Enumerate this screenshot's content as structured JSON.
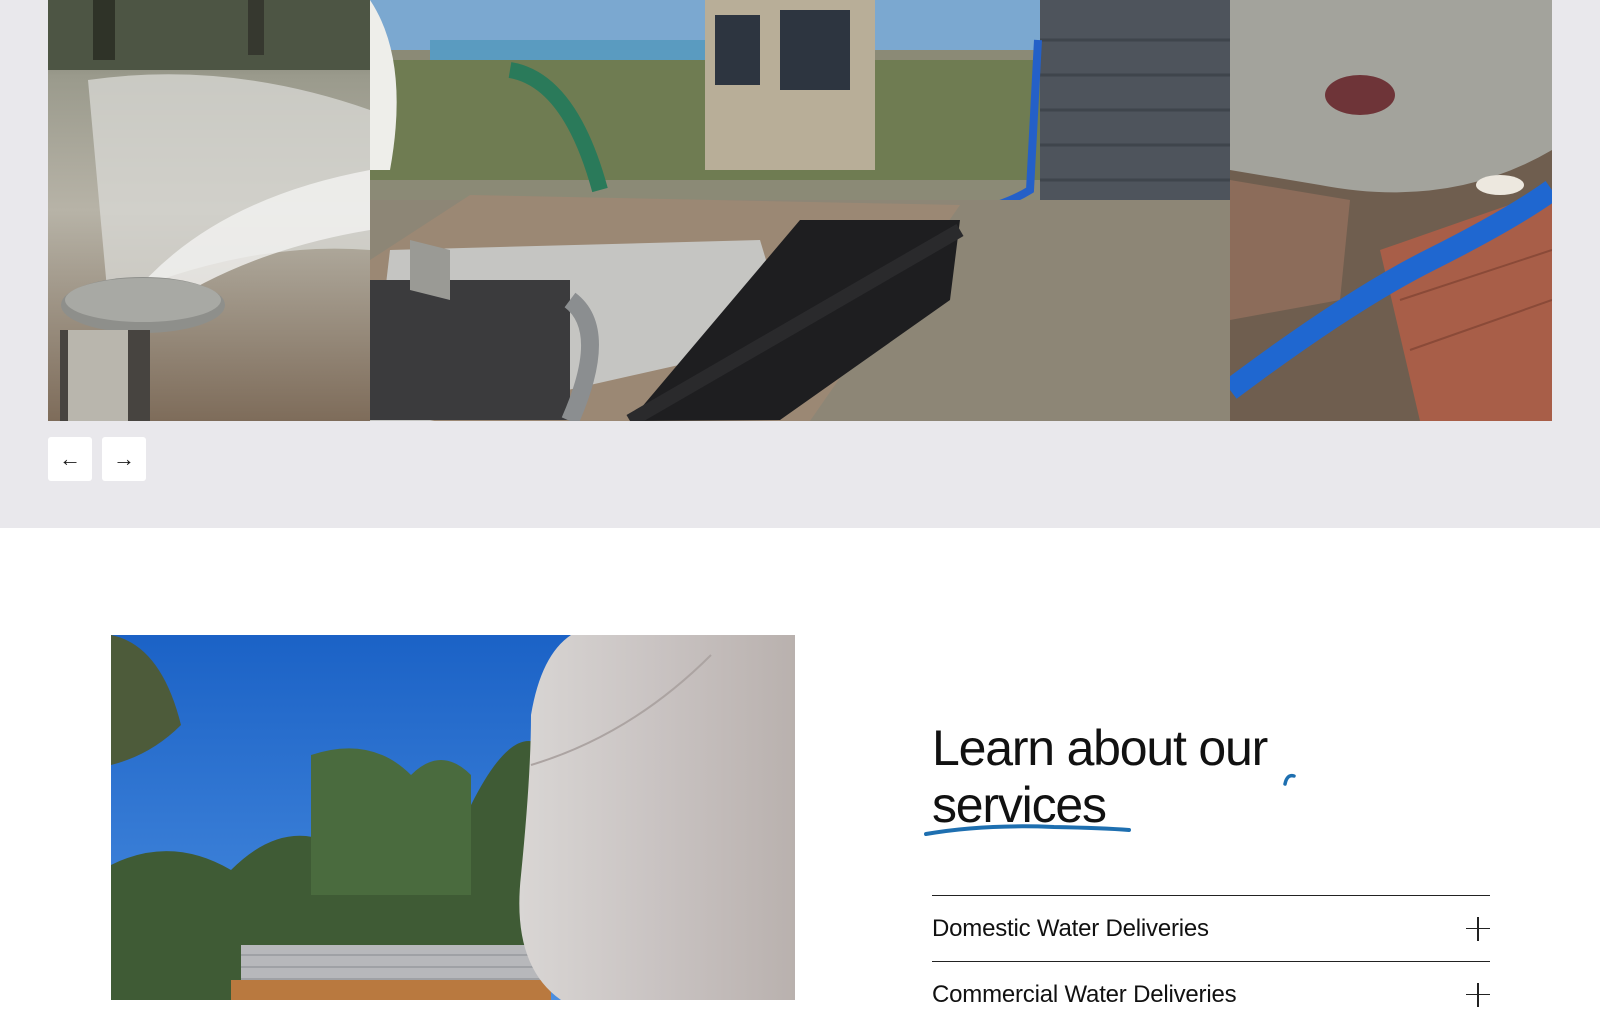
{
  "gallery": {
    "photos": [
      {
        "alt": "sprinkler-spraying-water"
      },
      {
        "alt": "water-truck-filling-tank"
      },
      {
        "alt": "blue-hose-on-rocks"
      }
    ],
    "prev_label": "←",
    "next_label": "→"
  },
  "services": {
    "heading_line1": "Learn about our",
    "heading_line2": "services",
    "accent_color": "#1e6fb0",
    "items": [
      {
        "label": "Domestic Water Deliveries"
      },
      {
        "label": "Commercial Water Deliveries"
      }
    ]
  }
}
